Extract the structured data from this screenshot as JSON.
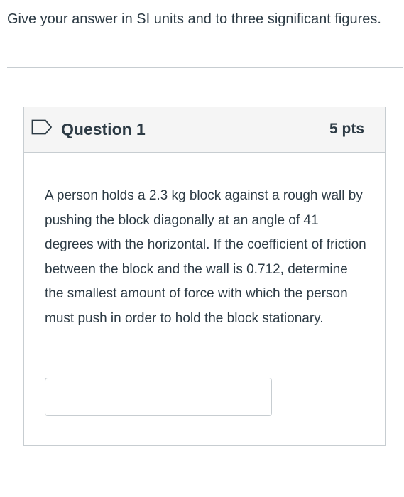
{
  "instructions": {
    "text": "Give your answer in SI units and to three significant figures."
  },
  "question": {
    "flag_icon": "flag-bookmark-icon",
    "title": "Question 1",
    "points": "5 pts",
    "body": "A person holds a 2.3 kg block against a rough wall by pushing the block diagonally at an angle of 41 degrees with the horizontal. If the coefficient of friction between the block and the wall is 0.712, determine the smallest amount of force with which the person must push in order to hold the block stationary.",
    "answer_value": ""
  },
  "colors": {
    "text": "#2d3b45",
    "border": "#c7cdd1",
    "header_bg": "#f5f5f5",
    "flag_stroke": "#2d3b45"
  }
}
